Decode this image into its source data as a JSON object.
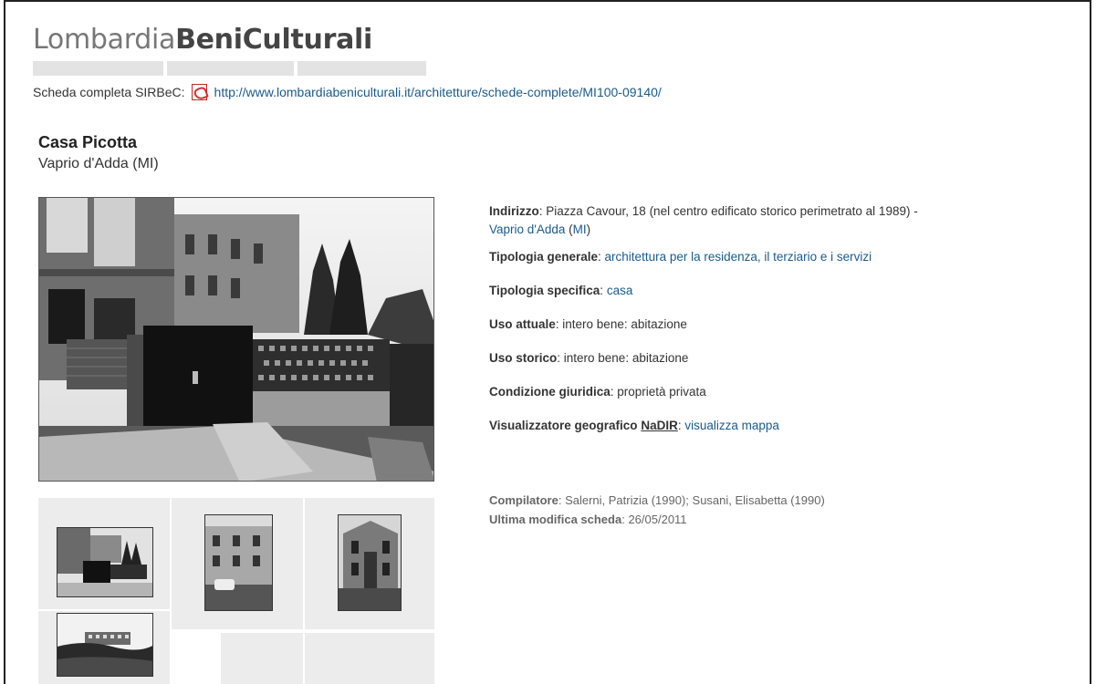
{
  "header": {
    "logo_part1": "Lombardia",
    "logo_part2": "BeniCulturali"
  },
  "scheda": {
    "label": "Scheda completa SIRBeC:",
    "icon": "pdf-icon",
    "url": "http://www.lombardiabeniculturali.it/architetture/schede-complete/MI100-09140/"
  },
  "record": {
    "title": "Casa Picotta",
    "location": "Vaprio d'Adda (MI)"
  },
  "details": {
    "indirizzo_label": "Indirizzo",
    "indirizzo_value": ": Piazza Cavour, 18 (nel centro edificato storico perimetrato al 1989) -",
    "indirizzo_comune": "Vaprio d'Adda",
    "indirizzo_prov": "MI",
    "tip_generale_label": "Tipologia generale",
    "tip_generale_value": "architettura per la residenza, il terziario e i servizi",
    "tip_specifica_label": "Tipologia specifica",
    "tip_specifica_value": "casa",
    "uso_attuale_label": "Uso attuale",
    "uso_attuale_value": ": intero bene: abitazione",
    "uso_storico_label": "Uso storico",
    "uso_storico_value": ": intero bene: abitazione",
    "condizione_label": "Condizione giuridica",
    "condizione_value": ": proprietà privata",
    "geo_label": "Visualizzatore geografico",
    "geo_nadir": "NaDIR",
    "geo_link": "visualizza mappa"
  },
  "meta": {
    "compilatore_label": "Compilatore",
    "compilatore_value": ": Salerni, Patrizia (1990); Susani, Elisabetta (1990)",
    "modifica_label": "Ultima modifica scheda",
    "modifica_value": ": 26/05/2011"
  }
}
